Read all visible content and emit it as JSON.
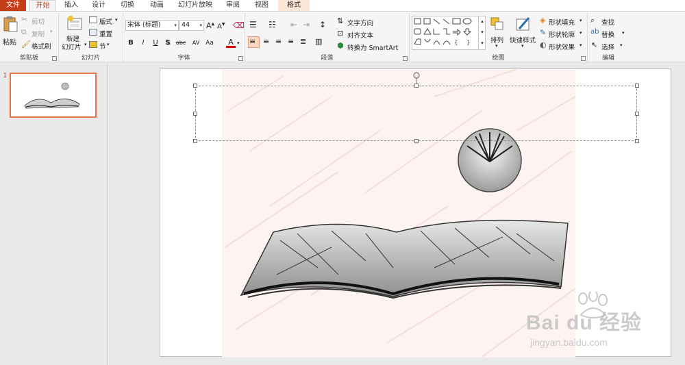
{
  "tabs": {
    "file": "文件",
    "home": "开始",
    "insert": "插入",
    "design": "设计",
    "transitions": "切换",
    "animations": "动画",
    "slideshow": "幻灯片放映",
    "review": "审阅",
    "view": "视图",
    "format": "格式"
  },
  "clipboard": {
    "paste": "粘贴",
    "cut": "剪切",
    "copy": "复制",
    "format_painter": "格式刷",
    "group": "剪贴板"
  },
  "slides": {
    "new_slide_line1": "新建",
    "new_slide_line2": "幻灯片",
    "layout": "版式",
    "reset": "重置",
    "section": "节",
    "group": "幻灯片"
  },
  "font": {
    "name": "宋体 (标题)",
    "size": "44",
    "group": "字体",
    "bold": "B",
    "italic": "I",
    "underline": "U",
    "shadow": "S",
    "strike": "abc",
    "spacing": "AV",
    "case": "Aa",
    "color": "A"
  },
  "paragraph": {
    "text_direction": "文字方向",
    "align_text": "对齐文本",
    "smartart": "转换为 SmartArt",
    "group": "段落"
  },
  "drawing": {
    "arrange": "排列",
    "quick_styles": "快速样式",
    "shape_fill": "形状填充",
    "shape_outline": "形状轮廓",
    "shape_effects": "形状效果",
    "group": "绘图"
  },
  "editing": {
    "find": "查找",
    "replace": "替换",
    "select": "选择",
    "group": "编辑"
  },
  "thumbnail": {
    "number": "1"
  },
  "watermark": {
    "brand": "Bai du 经验",
    "url": "jingyan.baidu.com"
  },
  "colors": {
    "accent": "#c43e1c",
    "thumb_border": "#e0754a",
    "format_tab": "#fbe6d8"
  }
}
